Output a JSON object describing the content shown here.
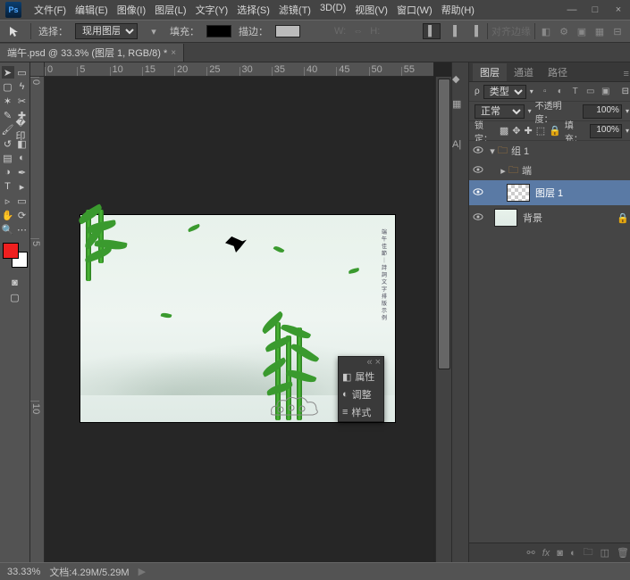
{
  "app": {
    "logo_text": "Ps"
  },
  "menu": {
    "file": "文件(F)",
    "edit": "编辑(E)",
    "image": "图像(I)",
    "layer": "图层(L)",
    "type": "文字(Y)",
    "select": "选择(S)",
    "filter": "滤镜(T)",
    "threeD": "3D(D)",
    "view": "视图(V)",
    "window": "窗口(W)",
    "help": "帮助(H)"
  },
  "window_controls": {
    "minimize": "—",
    "maximize": "□",
    "close": "×"
  },
  "optionbar": {
    "label_select": "选择：",
    "select_value": "现用图层",
    "label_fill": "填充：",
    "label_stroke": "描边：",
    "w_label": "W:",
    "h_label": "H:",
    "align_label": "对齐边缘"
  },
  "doc": {
    "tab_title": "端午.psd @ 33.3% (图层 1, RGB/8) *"
  },
  "ruler_h": [
    "0",
    "5",
    "10",
    "15",
    "20",
    "25",
    "30",
    "35",
    "40",
    "45",
    "50",
    "55"
  ],
  "ruler_v": [
    "0",
    "5",
    "10"
  ],
  "float_panel": {
    "props": "属性",
    "adjust": "调整",
    "styles": "样式"
  },
  "right_vertical_icons": [
    "color-icon",
    "swatches-icon",
    "paragraph-icon",
    "character-icon"
  ],
  "layer_panel": {
    "tabs": {
      "layers": "图层",
      "channels": "通道",
      "paths": "路径"
    },
    "kind_label": "类型",
    "blend_mode": "正常",
    "opacity_label": "不透明度：",
    "opacity_value": "100%",
    "lock_label": "锁定：",
    "fill_label": "填充：",
    "fill_value": "100%",
    "group1": "组 1",
    "group_duan": "端",
    "layer1": "图层 1",
    "background": "背景"
  },
  "statusbar": {
    "zoom": "33.33%",
    "doc_info": "文档:4.29M/5.29M",
    "arrow": "▶"
  },
  "colors": {
    "foreground": "#ef1f1f",
    "background_swatch": "#ffffff"
  }
}
